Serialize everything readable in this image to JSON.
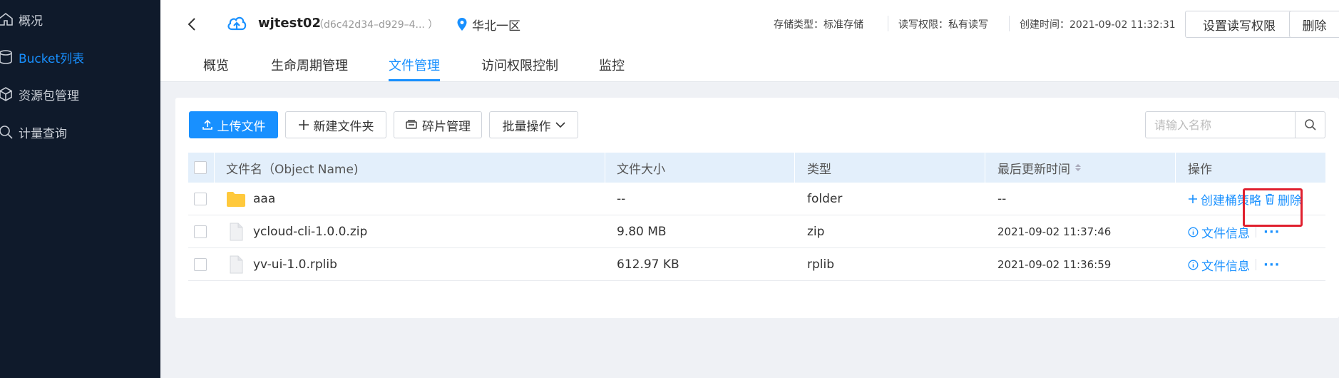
{
  "sidebar": {
    "items": [
      {
        "label": "概况",
        "icon": "home-icon",
        "active": false
      },
      {
        "label": "Bucket列表",
        "icon": "bucket-icon",
        "active": true
      },
      {
        "label": "资源包管理",
        "icon": "package-icon",
        "active": false
      },
      {
        "label": "计量查询",
        "icon": "search-icon",
        "active": false
      }
    ]
  },
  "header": {
    "bucket_name": "wjtest02",
    "bucket_id": "（d6c42d34–d929–4... ）",
    "region": "华北一区",
    "storage_type": "存储类型：标准存储",
    "rw_permission": "读写权限：私有读写",
    "created": "创建时间：2021-09-02 11:32:31",
    "set_permission_label": "设置读写权限",
    "delete_label": "删除"
  },
  "tabs": [
    {
      "label": "概览",
      "active": false
    },
    {
      "label": "生命周期管理",
      "active": false
    },
    {
      "label": "文件管理",
      "active": true
    },
    {
      "label": "访问权限控制",
      "active": false
    },
    {
      "label": "监控",
      "active": false
    }
  ],
  "toolbar": {
    "upload_label": "上传文件",
    "new_folder_label": "新建文件夹",
    "fragment_label": "碎片管理",
    "batch_label": "批量操作",
    "search_placeholder": "请输入名称"
  },
  "table": {
    "columns": [
      "文件名（Object Name)",
      "文件大小",
      "类型",
      "最后更新时间",
      "操作"
    ],
    "rows": [
      {
        "name": "aaa",
        "size": "--",
        "type": "folder",
        "updated": "--",
        "action1": "创建桶策略",
        "action2": "删除",
        "kind": "folder"
      },
      {
        "name": "ycloud-cli-1.0.0.zip",
        "size": "9.80 MB",
        "type": "zip",
        "updated": "2021-09-02 11:37:46",
        "action1": "文件信息",
        "action2": "···",
        "kind": "file"
      },
      {
        "name": "yv-ui-1.0.rplib",
        "size": "612.97 KB",
        "type": "rplib",
        "updated": "2021-09-02 11:36:59",
        "action1": "文件信息",
        "action2": "···",
        "kind": "file"
      }
    ]
  },
  "colors": {
    "accent": "#1890ff",
    "sidebar_bg": "#0f1a2b",
    "highlight": "#e0202e",
    "folder": "#ffc93c"
  }
}
